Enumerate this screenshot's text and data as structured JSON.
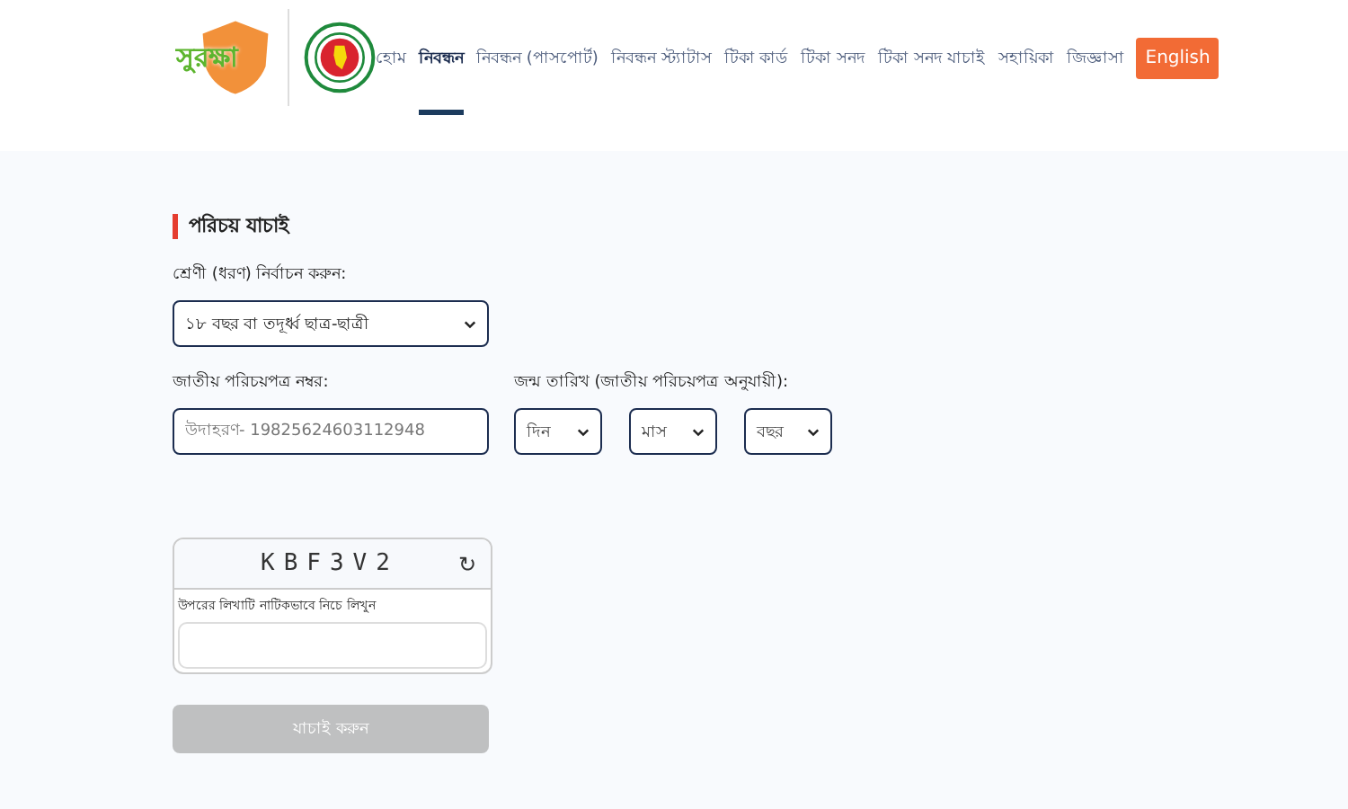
{
  "logo": {
    "text": "সুরক্ষা"
  },
  "nav": [
    {
      "label": "হোম",
      "selected": false
    },
    {
      "label": "নিবন্ধন",
      "selected": true
    },
    {
      "label": "নিবন্ধন (পাসপোর্ট)",
      "selected": false
    },
    {
      "label": "নিবন্ধন স্ট্যাটাস",
      "selected": false
    },
    {
      "label": "টিকা কার্ড",
      "selected": false
    },
    {
      "label": "টিকা সনদ",
      "selected": false
    },
    {
      "label": "টিকা সনদ যাচাই",
      "selected": false
    },
    {
      "label": "সহায়িকা",
      "selected": false
    },
    {
      "label": "জিজ্ঞাসা",
      "selected": false
    }
  ],
  "language_button": "English",
  "form": {
    "title": "পরিচয় যাচাই",
    "category_label": "শ্রেণী (ধরণ) নির্বাচন করুন:",
    "category_value": "১৮ বছর বা তদূর্ধ্ব ছাত্র-ছাত্রী",
    "nid_label": "জাতীয় পরিচয়পত্র নম্বর:",
    "nid_placeholder": "উদাহরণ- 19825624603112948",
    "dob_label": "জন্ম তারিখ (জাতীয় পরিচয়পত্র অনুযায়ী):",
    "dob_selects": [
      "দিন",
      "মাস",
      "বছর"
    ],
    "captcha": "KBF3V2",
    "refresh_icon": "↻",
    "captcha_label": "উপরের লিখাটি নাটিকভাবে নিচে লিখুন",
    "submit": {
      "label": "যাচাই করুন",
      "disabled": true
    }
  }
}
